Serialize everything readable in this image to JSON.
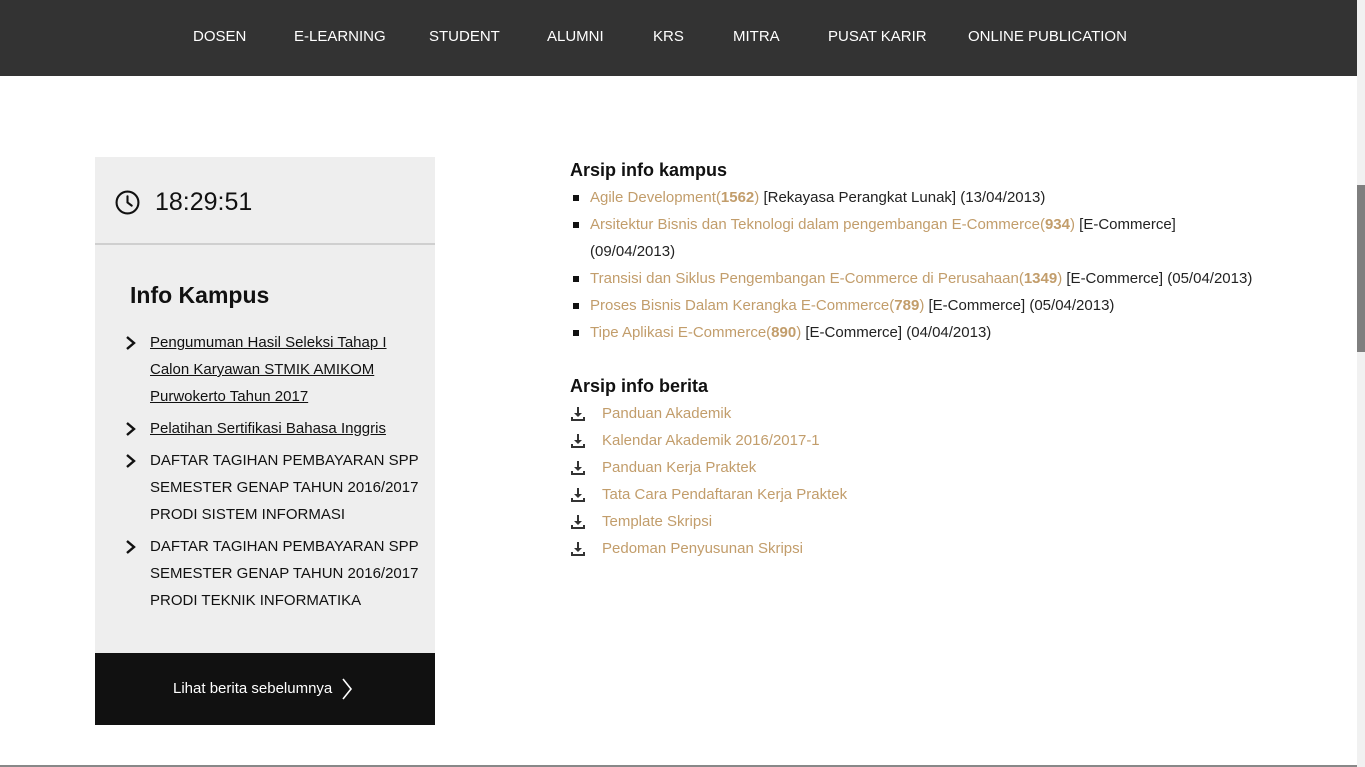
{
  "nav": {
    "items": [
      "DOSEN",
      "E-LEARNING",
      "STUDENT",
      "ALUMNI",
      "KRS",
      "MITRA",
      "PUSAT KARIR",
      "ONLINE PUBLICATION"
    ]
  },
  "clock": {
    "time": "18:29:51"
  },
  "info_kampus": {
    "title": "Info Kampus",
    "items": [
      {
        "text": "Pengumuman Hasil Seleksi Tahap I Calon Karyawan STMIK AMIKOM Purwokerto Tahun 2017"
      },
      {
        "text": "Pelatihan Sertifikasi Bahasa Inggris"
      },
      {
        "text": "DAFTAR TAGIHAN PEMBAYARAN SPP SEMESTER GENAP TAHUN 2016/2017 PRODI SISTEM INFORMASI"
      },
      {
        "text": "DAFTAR TAGIHAN PEMBAYARAN SPP SEMESTER GENAP TAHUN 2016/2017 PRODI TEKNIK INFORMATIKA"
      }
    ],
    "more_label": "Lihat berita sebelumnya"
  },
  "arsip_kampus": {
    "title": "Arsip info kampus",
    "items": [
      {
        "title": "Agile Development",
        "count": "1562",
        "category": "[Rekayasa Perangkat Lunak]",
        "date": "(13/04/2013)"
      },
      {
        "title": "Arsitektur Bisnis dan Teknologi dalam pengembangan E-Commerce",
        "count": "934",
        "category": "[E-Commerce]",
        "date": "(09/04/2013)"
      },
      {
        "title": "Transisi dan Siklus Pengembangan E-Commerce di Perusahaan",
        "count": "1349",
        "category": "[E-Commerce]",
        "date": "(05/04/2013)"
      },
      {
        "title": "Proses Bisnis Dalam Kerangka E-Commerce",
        "count": "789",
        "category": "[E-Commerce]",
        "date": "(05/04/2013)"
      },
      {
        "title": "Tipe Aplikasi E-Commerce",
        "count": "890",
        "category": "[E-Commerce]",
        "date": "(04/04/2013)"
      }
    ]
  },
  "arsip_berita": {
    "title": "Arsip info berita",
    "items": [
      "Panduan Akademik",
      "Kalendar Akademik 2016/2017-1",
      "Panduan Kerja Praktek",
      "Tata Cara Pendaftaran Kerja Praktek",
      "Template Skripsi",
      "Pedoman Penyusunan Skripsi"
    ]
  },
  "colors": {
    "nav_bg": "#333333",
    "link": "#c29d6b",
    "sidebar_bg": "#eeeeee",
    "button_bg": "#111111"
  }
}
